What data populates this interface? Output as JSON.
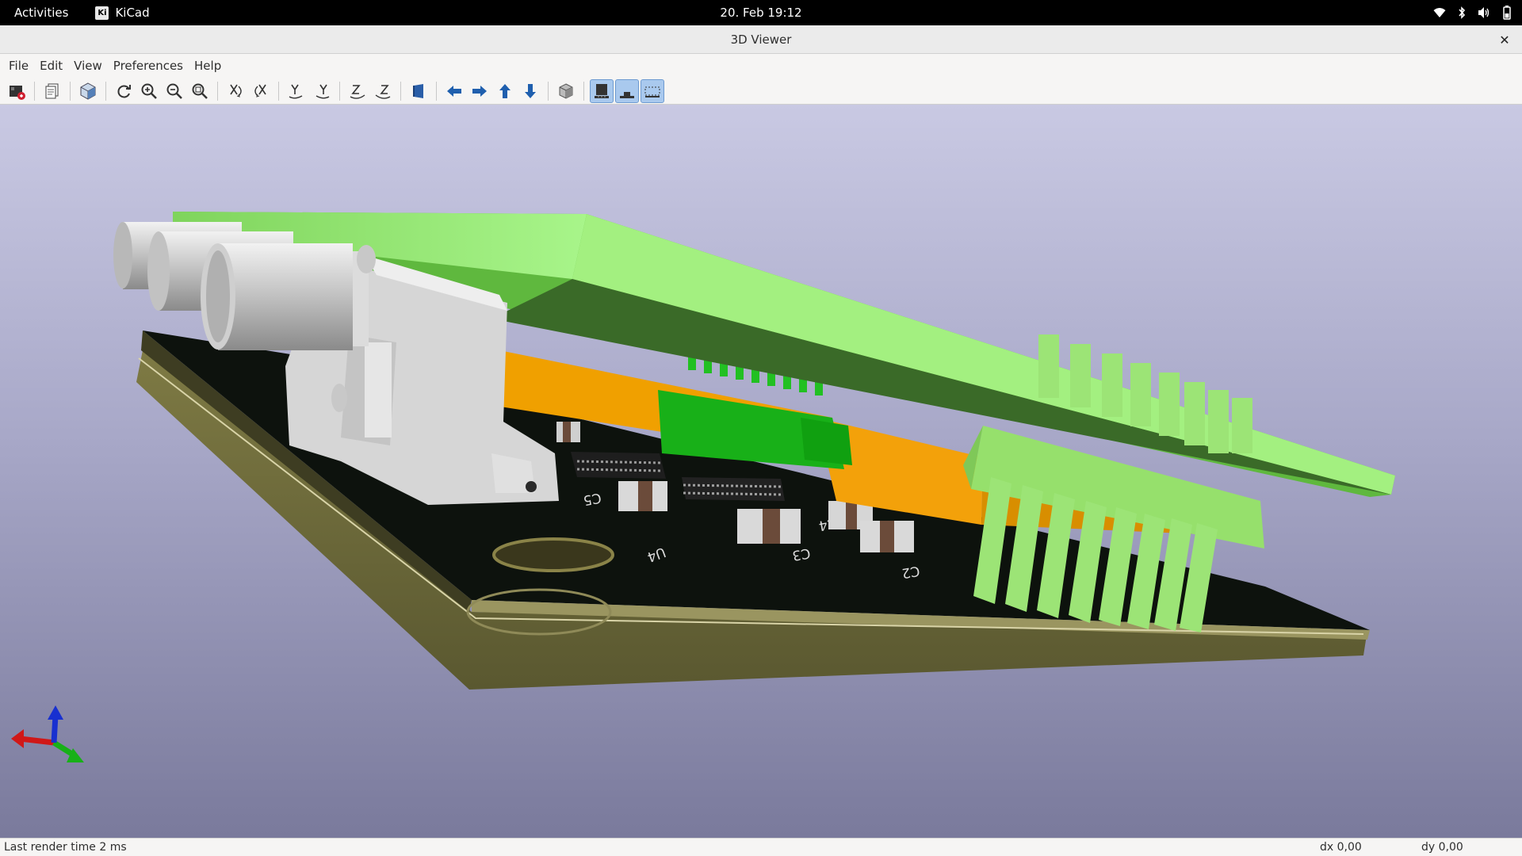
{
  "topbar": {
    "activities": "Activities",
    "app_name": "KiCad",
    "app_logo_text": "Ki",
    "clock": "20. Feb  19:12"
  },
  "window": {
    "title": "3D Viewer",
    "close_symbol": "✕"
  },
  "menubar": {
    "items": [
      "File",
      "Edit",
      "View",
      "Preferences",
      "Help"
    ]
  },
  "toolbar": {
    "icons": [
      "reload-board-icon",
      "copy-image-icon",
      "raytracing-icon",
      "refresh-icon",
      "zoom-in-icon",
      "zoom-out-icon",
      "zoom-fit-icon",
      "rotate-x-cw-icon",
      "rotate-x-ccw-icon",
      "rotate-y-cw-icon",
      "rotate-y-ccw-icon",
      "rotate-z-cw-icon",
      "rotate-z-ccw-icon",
      "flip-board-icon",
      "pan-left-icon",
      "pan-right-icon",
      "pan-up-icon",
      "pan-down-icon",
      "ortho-projection-icon",
      "show-tht-icon",
      "show-smd-icon",
      "show-virtual-icon"
    ],
    "active_toggles": [
      "show-tht-icon",
      "show-smd-icon",
      "show-virtual-icon"
    ]
  },
  "scene": {
    "silkscreen_labels": [
      "U4",
      "C5",
      "C4",
      "C3",
      "C2"
    ],
    "colors": {
      "background_top": "#c9c9e3",
      "background_bottom": "#7a7a9c",
      "board_solder_mask": "#0d120d",
      "board_substrate": "#6d6a3a",
      "module_green": "#8fe46a",
      "connector_orange": "#f0a000",
      "connector_silver": "#d6d6d6",
      "header_green": "#18b018"
    },
    "axis_gizmo": [
      "x-axis-red",
      "y-axis-green",
      "z-axis-blue"
    ]
  },
  "statusbar": {
    "render_time": "Last render time 2 ms",
    "dx": "dx 0,00",
    "dy": "dy 0,00"
  }
}
